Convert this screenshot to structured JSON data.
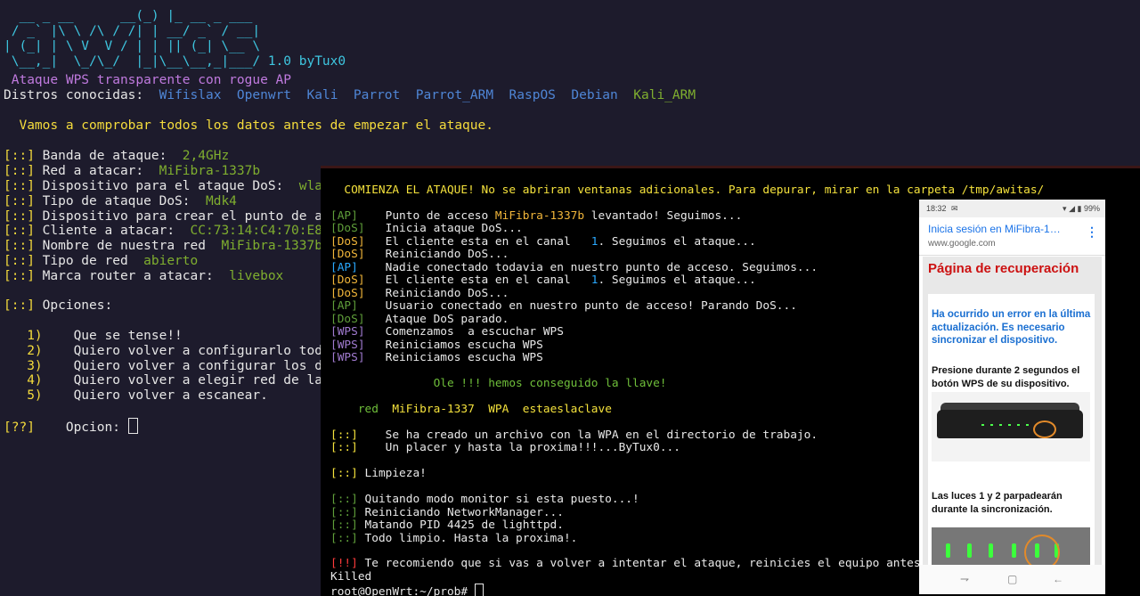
{
  "bg_terminal": {
    "banner_art": [
      "  __ _ __      __(_) |_ __ _ ___",
      " / _` |\\ \\ /\\ / /| | __/ _` / __|",
      "| (_| | \\ V  V / | | || (_| \\__ \\",
      " \\__,_|  \\_/\\_/  |_|\\__\\__,_|___/"
    ],
    "version": "1.0 byTux0",
    "subtitle": " Ataque WPS transparente con rogue AP",
    "distros_label": "Distros conocidas:",
    "distros": [
      "Wifislax",
      "Openwrt",
      "Kali",
      "Parrot",
      "Parrot_ARM",
      "RaspOS",
      "Debian",
      "Kali_ARM"
    ],
    "check_msg": "  Vamos a comprobar todos los datos antes de empezar el ataque.",
    "prefix": "[::]",
    "info": [
      {
        "label": " Banda de ataque:  ",
        "value": "2,4GHz"
      },
      {
        "label": " Red a atacar:  ",
        "value": "MiFibra-1337b"
      },
      {
        "label": " Dispositivo para el ataque DoS:  ",
        "value": "wla"
      },
      {
        "label": " Tipo de ataque DoS:  ",
        "value": "Mdk4"
      },
      {
        "label": " Dispositivo para crear el punto de a",
        "value": ""
      },
      {
        "label": " Cliente a atacar:  ",
        "value": "CC:73:14:C4:70:E8"
      },
      {
        "label": " Nombre de nuestra red  ",
        "value": "MiFibra-1337b"
      },
      {
        "label": " Tipo de red  ",
        "value": "abierto"
      },
      {
        "label": " Marca router a atacar:  ",
        "value": "livebox"
      }
    ],
    "options_title": " Opciones:",
    "options": [
      {
        "num": "   1)",
        "text": "    Que se tense!!"
      },
      {
        "num": "   2)",
        "text": "    Quiero volver a configurarlo todo"
      },
      {
        "num": "   3)",
        "text": "    Quiero volver a configurar los da"
      },
      {
        "num": "   4)",
        "text": "    Quiero volver a elegir red de las"
      },
      {
        "num": "   5)",
        "text": "    Quiero volver a escanear."
      }
    ],
    "prompt_prefix": "[??]",
    "prompt_label": "    Opcion: "
  },
  "fg_terminal": {
    "header": "  COMIENZA EL ATAQUE! No se abriran ventanas adicionales. Para depurar, mirar en la carpeta /tmp/awitas/",
    "log": [
      {
        "tag": "[AP]",
        "pre": "    Punto de acceso ",
        "hl": "MiFibra-1337b",
        "post": " levantado! Seguimos..."
      },
      {
        "tag": "[DoS]",
        "pre": "   Inicia ataque DoS...",
        "hl": "",
        "post": ""
      },
      {
        "tag": "[DoS]",
        "pre": "   El cliente esta en el canal   ",
        "hl": "1",
        "post": ". Seguimos el ataque..."
      },
      {
        "tag": "[DoS]",
        "pre": "   Reiniciando DoS...",
        "hl": "",
        "post": ""
      },
      {
        "tag": "[AP]",
        "pre": "    Nadie conectado todavia en nuestro punto de acceso. Seguimos...",
        "hl": "",
        "post": ""
      },
      {
        "tag": "[DoS]",
        "pre": "   El cliente esta en el canal   ",
        "hl": "1",
        "post": ". Seguimos el ataque..."
      },
      {
        "tag": "[DoS]",
        "pre": "   Reiniciando DoS...",
        "hl": "",
        "post": ""
      },
      {
        "tag": "[AP]",
        "pre": "    Usuario conectado en nuestro punto de acceso! Parando DoS...",
        "hl": "",
        "post": ""
      },
      {
        "tag": "[DoS]",
        "pre": "   Ataque DoS parado.",
        "hl": "",
        "post": ""
      },
      {
        "tag": "[WPS]",
        "pre": "   Comenzamos  a escuchar WPS",
        "hl": "",
        "post": ""
      },
      {
        "tag": "[WPS]",
        "pre": "   Reiniciamos escucha WPS",
        "hl": "",
        "post": ""
      },
      {
        "tag": "[WPS]",
        "pre": "   Reiniciamos escucha WPS",
        "hl": "",
        "post": ""
      }
    ],
    "got_key": "               Ole !!! hemos conseguido la llave!",
    "result_red": "    red",
    "result_ssid": "  MiFibra-1337",
    "result_sec": "  WPA",
    "result_key": "  estaeslaclave",
    "file_msg_1": "    Se ha creado un archivo con la WPA en el directorio de trabajo.",
    "file_msg_2": "    Un placer y hasta la proxima!!!...ByTux0...",
    "cleanup": " Limpieza!",
    "cleanup_steps": [
      " Quitando modo monitor si esta puesto...!",
      " Reiniciando NetworkManager...",
      " Matando PID 4425 de lighttpd.",
      " Todo limpio. Hasta la proxima!."
    ],
    "warn_tag": "[!!]",
    "warn_msg": " Te recomiendo que si vas a volver a intentar el ataque, reinicies el equipo antes. La l",
    "killed": "Killed",
    "prompt": "root@OpenWrt:~/prob# "
  },
  "phone": {
    "time": "18:32",
    "battery": "99%",
    "tab_title": "Inicia sesión en MiFibra-1…",
    "domain": "www.google.com",
    "heading": "Página de recuperación",
    "error_msg": "Ha ocurrido un error en la última actualización. Es necesario sincronizar el dispositivo.",
    "instruction": "Presione durante 2 segundos el botón WPS de su dispositivo.",
    "leds_msg": "Las luces 1 y 2 parpadearán durante la sincronización.",
    "nav_recent": "⇁",
    "nav_home": "▢",
    "nav_back": "←"
  },
  "colors": {
    "bg_terminal": "#1d1b2c",
    "fg_terminal": "#000000",
    "banner": "#3ec6e0",
    "subtitle": "#c07adf",
    "accent_yellow": "#f5dc3c",
    "value_green": "#7fae2f",
    "distro_blue": "#4f86d6",
    "error_red": "#cc1111",
    "link_blue": "#1a6fd1"
  }
}
